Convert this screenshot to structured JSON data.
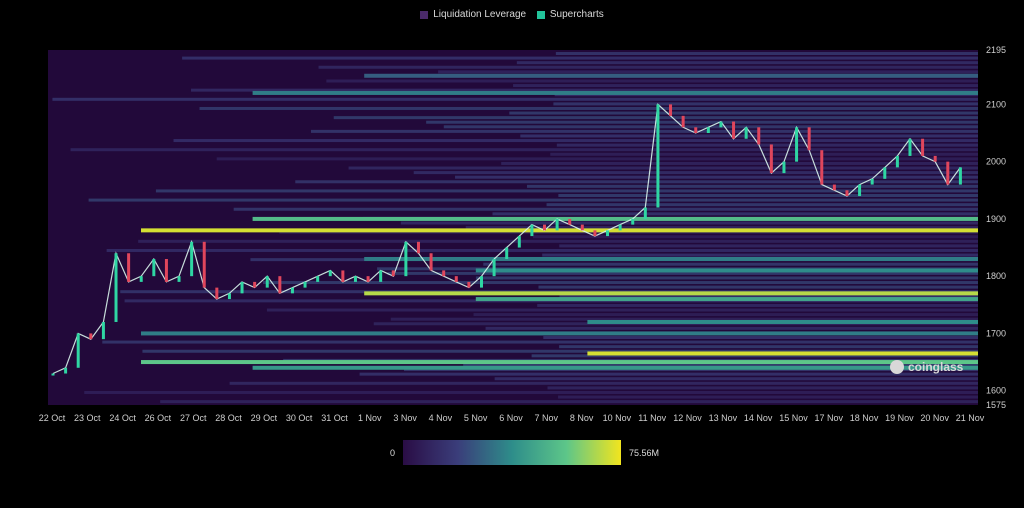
{
  "legend": [
    {
      "label": "Liquidation Leverage",
      "color": "#4a2a6a"
    },
    {
      "label": "Supercharts",
      "color": "#22c39a"
    }
  ],
  "watermark": "coinglass",
  "colorbar": {
    "min_label": "0",
    "max_label": "75.56M",
    "colors": [
      "#2a0d45",
      "#3a3d7a",
      "#2e8d8a",
      "#5dc689",
      "#f2e51e"
    ]
  },
  "chart_data": {
    "type": "heatmap",
    "title": "",
    "x_tick_labels": [
      "22 Oct",
      "23 Oct",
      "24 Oct",
      "26 Oct",
      "27 Oct",
      "28 Oct",
      "29 Oct",
      "30 Oct",
      "31 Oct",
      "1 Nov",
      "3 Nov",
      "4 Nov",
      "5 Nov",
      "6 Nov",
      "7 Nov",
      "8 Nov",
      "10 Nov",
      "11 Nov",
      "12 Nov",
      "13 Nov",
      "14 Nov",
      "15 Nov",
      "17 Nov",
      "18 Nov",
      "19 Nov",
      "20 Nov",
      "21 Nov"
    ],
    "y_ticks": [
      2195,
      2100,
      2000,
      1900,
      1800,
      1700,
      1600,
      1575
    ],
    "ylim": [
      1575,
      2195
    ],
    "value_range": [
      0,
      75560000
    ],
    "price_candles_close": [
      1630,
      1640,
      1700,
      1690,
      1720,
      1840,
      1790,
      1800,
      1830,
      1790,
      1800,
      1860,
      1780,
      1760,
      1770,
      1790,
      1780,
      1800,
      1770,
      1780,
      1790,
      1800,
      1810,
      1790,
      1800,
      1790,
      1810,
      1800,
      1860,
      1840,
      1810,
      1800,
      1790,
      1780,
      1800,
      1830,
      1850,
      1870,
      1890,
      1880,
      1900,
      1890,
      1880,
      1870,
      1880,
      1890,
      1900,
      1920,
      2100,
      2080,
      2060,
      2050,
      2060,
      2070,
      2040,
      2060,
      2030,
      1980,
      2000,
      2060,
      2020,
      1960,
      1950,
      1940,
      1960,
      1970,
      1990,
      2010,
      2040,
      2010,
      2000,
      1960,
      1990
    ],
    "liquidation_bands": [
      {
        "price": 1880,
        "intensity": 0.95
      },
      {
        "price": 1900,
        "intensity": 0.7
      },
      {
        "price": 1770,
        "intensity": 0.9
      },
      {
        "price": 1760,
        "intensity": 0.6
      },
      {
        "price": 1665,
        "intensity": 0.95
      },
      {
        "price": 1650,
        "intensity": 0.75
      },
      {
        "price": 1640,
        "intensity": 0.55
      },
      {
        "price": 1830,
        "intensity": 0.45
      },
      {
        "price": 1810,
        "intensity": 0.5
      },
      {
        "price": 1720,
        "intensity": 0.5
      },
      {
        "price": 1700,
        "intensity": 0.45
      },
      {
        "price": 2120,
        "intensity": 0.45
      },
      {
        "price": 2150,
        "intensity": 0.35
      }
    ]
  }
}
